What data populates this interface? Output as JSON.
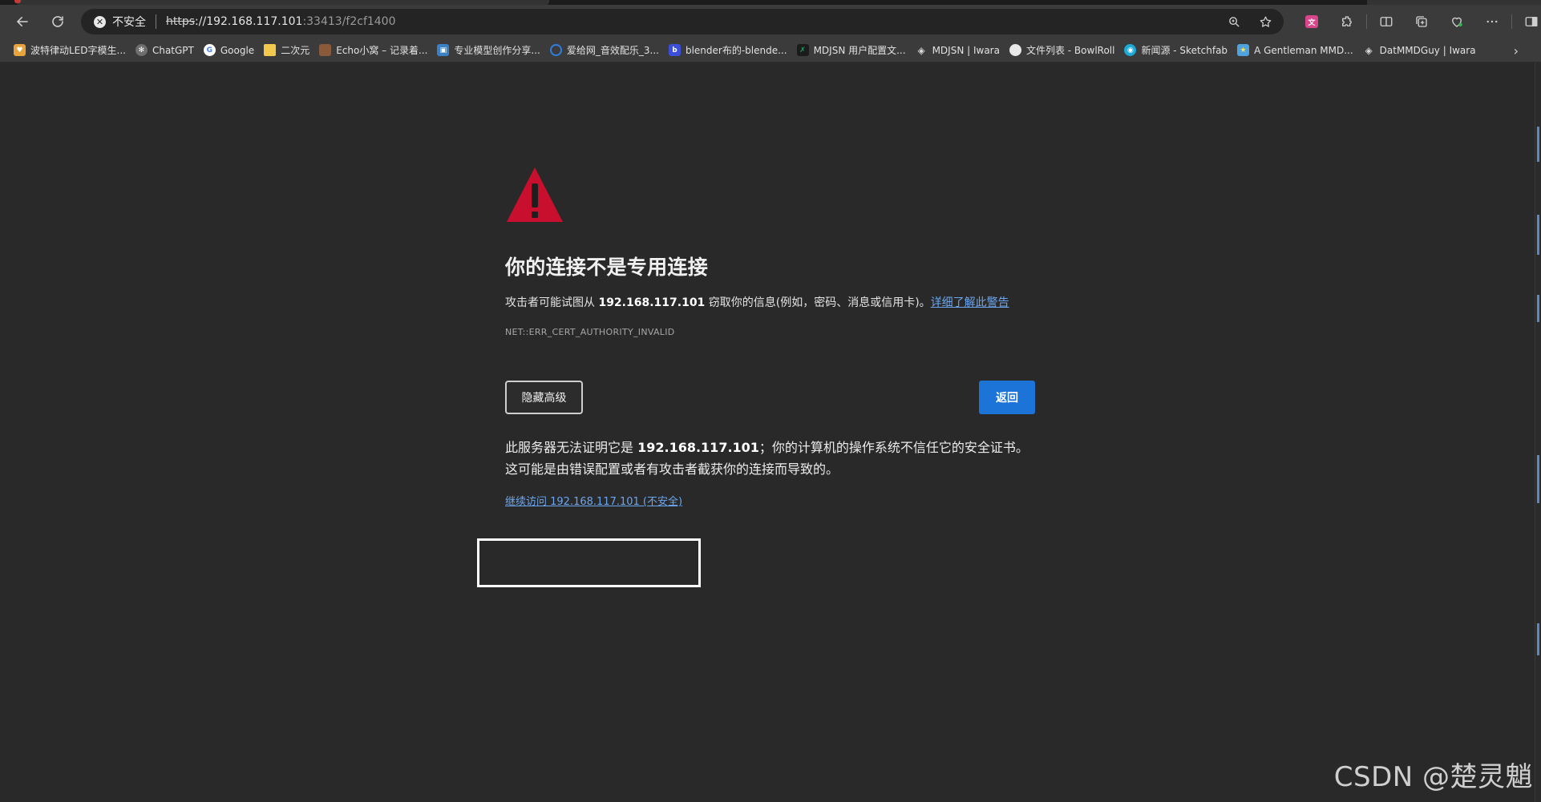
{
  "browser": {
    "address_bar": {
      "security_label": "不安全",
      "url_scheme": "https",
      "url_host": "://192.168.117.101",
      "url_rest": ":33413/f2cf1400"
    },
    "bookmarks": [
      {
        "label": "波特律动LED字模生...",
        "icon": "heart-icon",
        "color": "#e8a33b"
      },
      {
        "label": "ChatGPT",
        "icon": "chatgpt-icon",
        "color": "#6e6e6e"
      },
      {
        "label": "Google",
        "icon": "google-icon",
        "color": "#ffffff"
      },
      {
        "label": "二次元",
        "icon": "folder-icon",
        "color": "#f2c94c"
      },
      {
        "label": "Echo小窝 – 记录着...",
        "icon": "avatar-icon",
        "color": "#8a5a3a"
      },
      {
        "label": "专业模型创作分享...",
        "icon": "model-share-icon",
        "color": "#3b82c4"
      },
      {
        "label": "爱给网_音效配乐_3...",
        "icon": "aigei-icon",
        "color": "#2f7fe0"
      },
      {
        "label": "blender布的-blende...",
        "icon": "blender-b-icon",
        "color": "#3b4fd8"
      },
      {
        "label": "MDJSN 用户配置文...",
        "icon": "mdjsn-icon",
        "color": "#1f9e62"
      },
      {
        "label": "MDJSN | Iwara",
        "icon": "iwara-icon",
        "color": "#dcdcdc"
      },
      {
        "label": "文件列表 - BowlRoll",
        "icon": "bowlroll-icon",
        "color": "#e8e8e8"
      },
      {
        "label": "新闻源 - Sketchfab",
        "icon": "sketchfab-icon",
        "color": "#1caad9"
      },
      {
        "label": "A Gentleman MMD...",
        "icon": "star-icon",
        "color": "#4fa3e0"
      },
      {
        "label": "DatMMDGuy | Iwara",
        "icon": "iwara-icon",
        "color": "#dcdcdc"
      }
    ]
  },
  "page": {
    "heading": "你的连接不是专用连接",
    "intro_prefix": "攻击者可能试图从 ",
    "intro_host": "192.168.117.101",
    "intro_suffix": " 窃取你的信息(例如，密码、消息或信用卡)。",
    "learn_more": "详细了解此警告",
    "error_code": "NET::ERR_CERT_AUTHORITY_INVALID",
    "hide_advanced_button": "隐藏高级",
    "back_button": "返回",
    "detail_prefix": "此服务器无法证明它是 ",
    "detail_host": "192.168.117.101",
    "detail_suffix": "；你的计算机的操作系统不信任它的安全证书。这可能是由错误配置或者有攻击者截获你的连接而导致的。",
    "proceed_link": "继续访问 192.168.117.101 (不安全)"
  },
  "watermark": "CSDN @楚灵魈",
  "colors": {
    "warning_red": "#c8102e",
    "link_blue": "#6ba6f0",
    "primary_button": "#1d74d8"
  }
}
